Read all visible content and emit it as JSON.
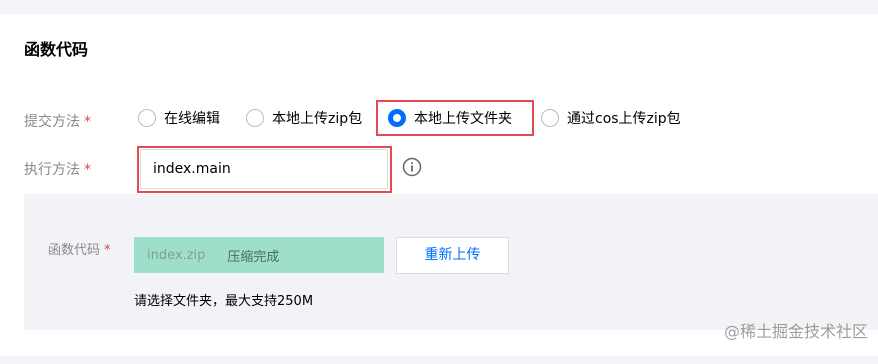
{
  "section": {
    "title": "函数代码"
  },
  "submit_method": {
    "label": "提交方法",
    "required_mark": "*",
    "options": [
      {
        "label": "在线编辑",
        "selected": false
      },
      {
        "label": "本地上传zip包",
        "selected": false
      },
      {
        "label": "本地上传文件夹",
        "selected": true
      },
      {
        "label": "通过cos上传zip包",
        "selected": false
      }
    ]
  },
  "exec_method": {
    "label": "执行方法",
    "required_mark": "*",
    "value": "index.main"
  },
  "code_panel": {
    "label": "函数代码",
    "required_mark": "*",
    "zip_name": "index.zip",
    "zip_status": "压缩完成",
    "reupload_label": "重新上传",
    "hint": "请选择文件夹，最大支持250M"
  },
  "watermark": "@稀土掘金技术社区",
  "colors": {
    "accent": "#006eff",
    "highlight": "#e44a4f",
    "success_bg": "#9edfcc"
  }
}
